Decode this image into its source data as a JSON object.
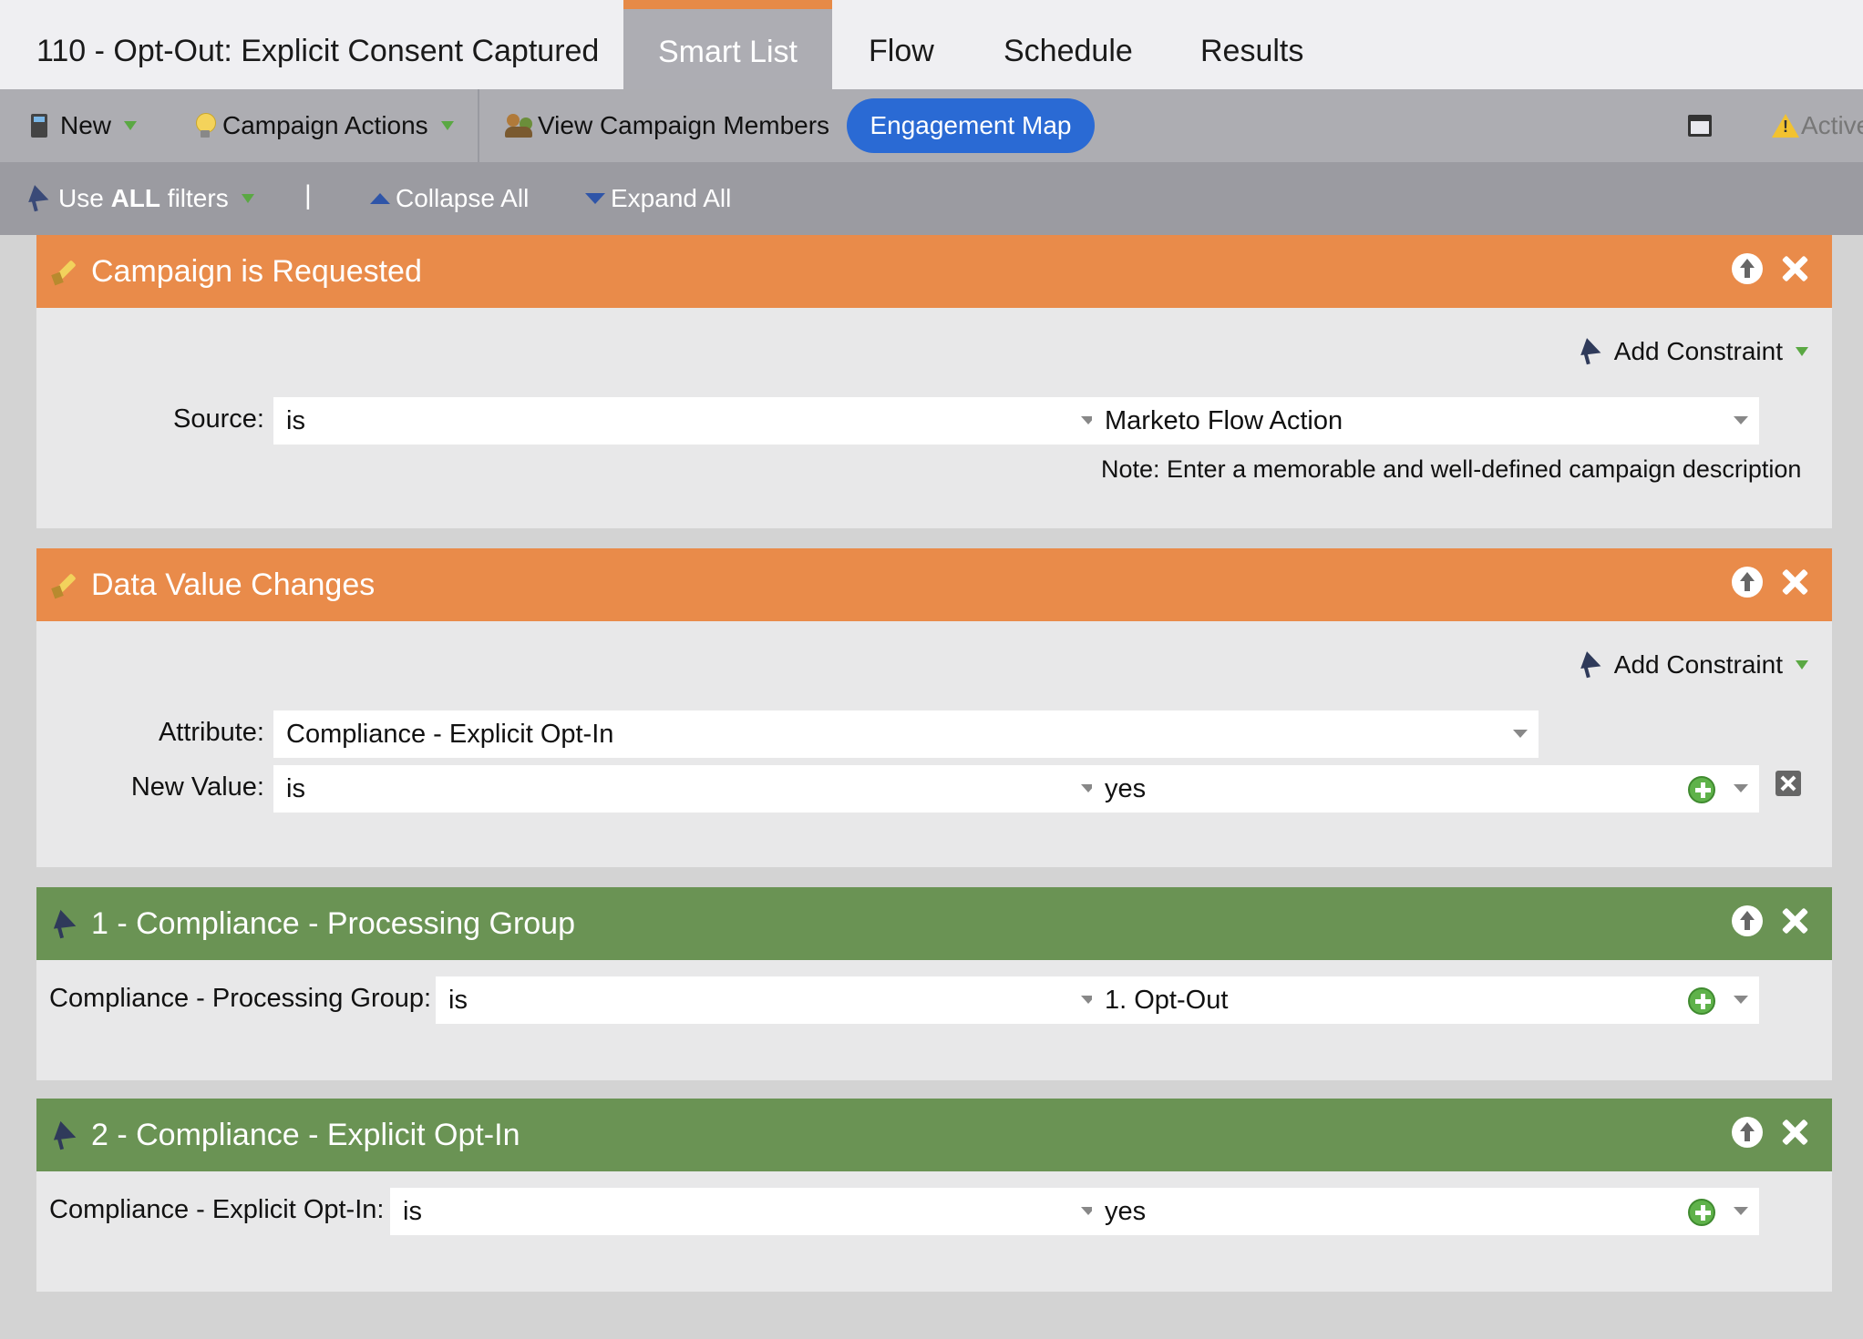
{
  "tabs": {
    "title": "110 - Opt-Out: Explicit Consent Captured",
    "items": [
      {
        "label": "Smart List",
        "active": true
      },
      {
        "label": "Flow"
      },
      {
        "label": "Schedule"
      },
      {
        "label": "Results"
      }
    ]
  },
  "toolbar": {
    "new_label": "New",
    "campaign_actions_label": "Campaign Actions",
    "view_members_label": "View Campaign Members",
    "engagement_map_label": "Engagement Map",
    "status_label": "Active"
  },
  "filter_toolbar": {
    "use_filters_prefix": "Use ",
    "use_filters_bold": "ALL",
    "use_filters_suffix": " filters",
    "separator": "|",
    "collapse_label": "Collapse All",
    "expand_label": "Expand All"
  },
  "blocks": [
    {
      "title": "Campaign is Requested",
      "type": "trigger",
      "add_constraint": "Add Constraint",
      "rows": [
        {
          "label": "Source:",
          "operator": "is",
          "value": "Marketo Flow Action"
        }
      ],
      "note": "Note: Enter a memorable and well-defined campaign description"
    },
    {
      "title": "Data Value Changes",
      "type": "trigger",
      "add_constraint": "Add Constraint",
      "rows": [
        {
          "label": "Attribute:",
          "value": "Compliance - Explicit Opt-In"
        },
        {
          "label": "New Value:",
          "operator": "is",
          "value": "yes"
        }
      ]
    },
    {
      "title": "1 - Compliance - Processing Group",
      "type": "filter",
      "rows": [
        {
          "label": "Compliance - Processing Group:",
          "operator": "is",
          "value": "1. Opt-Out"
        }
      ]
    },
    {
      "title": "2 - Compliance - Explicit Opt-In",
      "type": "filter",
      "rows": [
        {
          "label": "Compliance - Explicit Opt-In:",
          "operator": "is",
          "value": "yes"
        }
      ]
    }
  ],
  "colors": {
    "trigger_header": "#e98b4a",
    "filter_header": "#6a9354",
    "accent_tab": "#e68a47",
    "engagement_map_button": "#2a6ad4"
  }
}
